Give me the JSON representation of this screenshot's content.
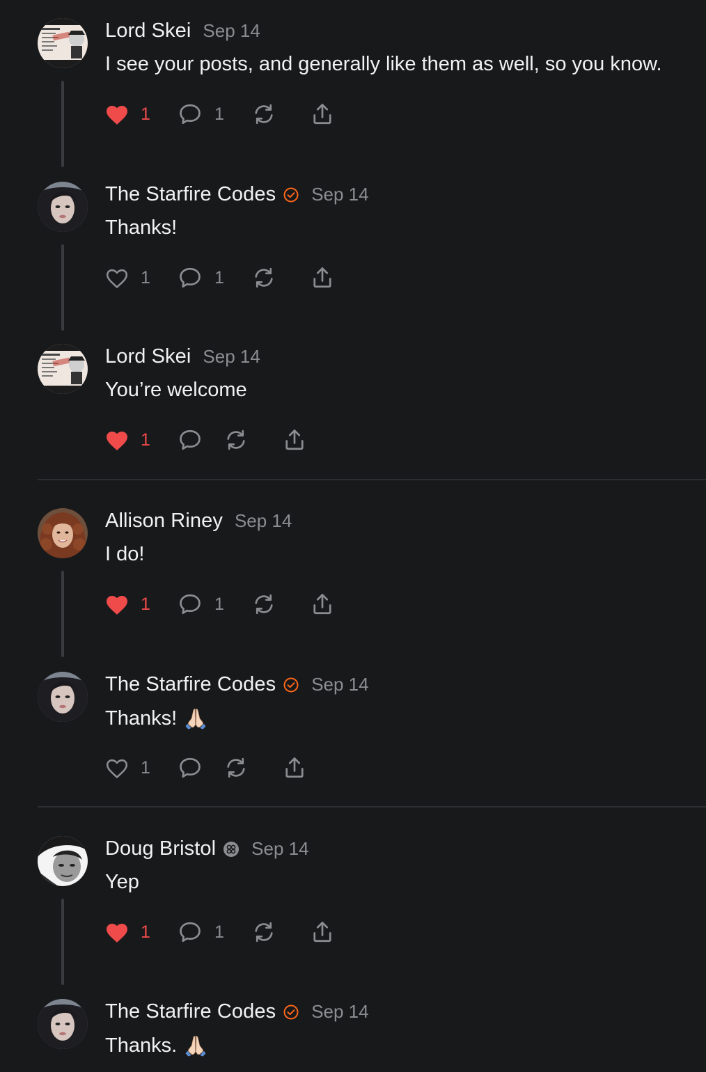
{
  "accent": {
    "like": "#ef4b4b",
    "verified": "#ff6719",
    "muted": "#8c8d91"
  },
  "comments": [
    {
      "author": "Lord Skei",
      "date": "Sep 14",
      "text": "I see your posts, and generally like them as well, so you know.",
      "likes": "1",
      "liked": true,
      "replies": "1",
      "badge": "none",
      "avatar": "lord-skei"
    },
    {
      "author": "The Starfire Codes",
      "date": "Sep 14",
      "text": "Thanks!",
      "likes": "1",
      "liked": false,
      "replies": "1",
      "badge": "verified",
      "avatar": "starfire"
    },
    {
      "author": "Lord Skei",
      "date": "Sep 14",
      "text": "You’re welcome",
      "likes": "1",
      "liked": true,
      "replies": "",
      "badge": "none",
      "avatar": "lord-skei"
    },
    {
      "author": "Allison Riney",
      "date": "Sep 14",
      "text": "I do!",
      "likes": "1",
      "liked": true,
      "replies": "1",
      "badge": "none",
      "avatar": "allison"
    },
    {
      "author": "The Starfire Codes",
      "date": "Sep 14",
      "text": "Thanks!",
      "emoji": "🙏🏻",
      "likes": "1",
      "liked": false,
      "replies": "",
      "badge": "verified",
      "avatar": "starfire"
    },
    {
      "author": "Doug Bristol",
      "date": "Sep 14",
      "text": "Yep",
      "likes": "1",
      "liked": true,
      "replies": "1",
      "badge": "founding",
      "avatar": "doug"
    },
    {
      "author": "The Starfire Codes",
      "date": "Sep 14",
      "text": "Thanks.",
      "emoji": "🙏🏻",
      "badge": "verified",
      "avatar": "starfire"
    }
  ]
}
